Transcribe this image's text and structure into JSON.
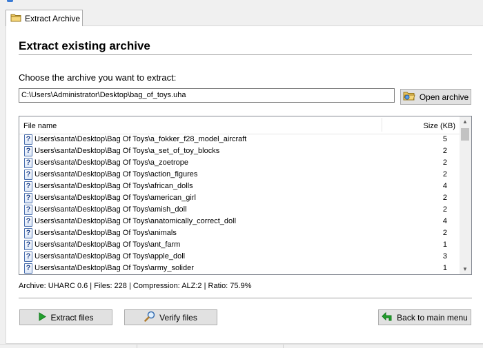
{
  "tab": {
    "label": "Extract Archive",
    "icon": "folder-icon"
  },
  "heading": "Extract existing archive",
  "choose_label": "Choose the archive you want to extract:",
  "archive_path": "C:\\Users\\Administrator\\Desktop\\bag_of_toys.uha",
  "open_button": {
    "label": "Open archive",
    "icon": "open-folder-icon"
  },
  "file_list": {
    "columns": [
      "File name",
      "Size (KB)"
    ],
    "rows": [
      {
        "name": "Users\\santa\\Desktop\\Bag Of Toys\\a_fokker_f28_model_aircraft",
        "size": "5"
      },
      {
        "name": "Users\\santa\\Desktop\\Bag Of Toys\\a_set_of_toy_blocks",
        "size": "2"
      },
      {
        "name": "Users\\santa\\Desktop\\Bag Of Toys\\a_zoetrope",
        "size": "2"
      },
      {
        "name": "Users\\santa\\Desktop\\Bag Of Toys\\action_figures",
        "size": "2"
      },
      {
        "name": "Users\\santa\\Desktop\\Bag Of Toys\\african_dolls",
        "size": "4"
      },
      {
        "name": "Users\\santa\\Desktop\\Bag Of Toys\\american_girl",
        "size": "2"
      },
      {
        "name": "Users\\santa\\Desktop\\Bag Of Toys\\amish_doll",
        "size": "2"
      },
      {
        "name": "Users\\santa\\Desktop\\Bag Of Toys\\anatomically_correct_doll",
        "size": "4"
      },
      {
        "name": "Users\\santa\\Desktop\\Bag Of Toys\\animals",
        "size": "2"
      },
      {
        "name": "Users\\santa\\Desktop\\Bag Of Toys\\ant_farm",
        "size": "1"
      },
      {
        "name": "Users\\santa\\Desktop\\Bag Of Toys\\apple_doll",
        "size": "3"
      },
      {
        "name": "Users\\santa\\Desktop\\Bag Of Toys\\army_solider",
        "size": "1"
      }
    ]
  },
  "status": "Archive: UHARC 0.6 | Files: 228 | Compression: ALZ:2 | Ratio: 75.9%",
  "buttons": {
    "extract": {
      "label": "Extract files",
      "icon": "play-icon"
    },
    "verify": {
      "label": "Verify files",
      "icon": "magnifier-icon"
    },
    "back": {
      "label": "Back to main menu",
      "icon": "back-arrow-icon"
    }
  },
  "colors": {
    "accent_green": "#22a02e",
    "folder_yellow": "#e8c25a",
    "question_blue": "#1a3f8a"
  }
}
